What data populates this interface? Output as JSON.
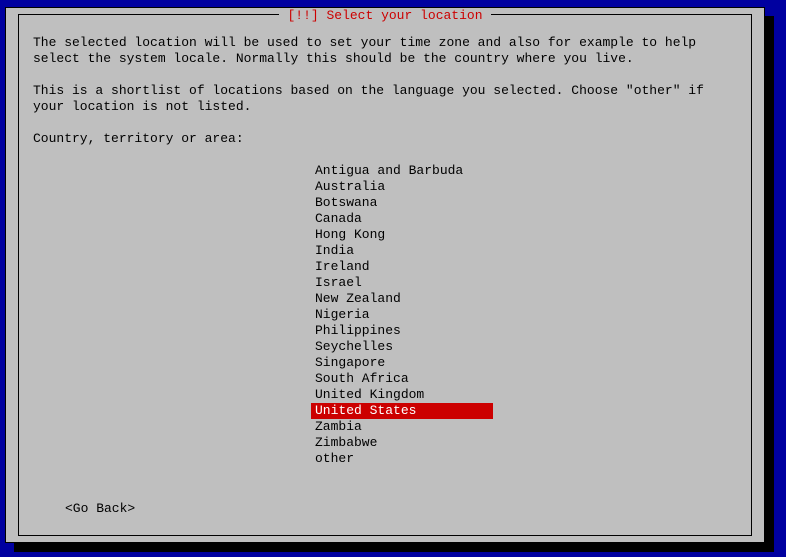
{
  "dialog": {
    "title": "[!!] Select your location",
    "paragraph1": "The selected location will be used to set your time zone and also for example to help select the system locale. Normally this should be the country where you live.",
    "paragraph2": "This is a shortlist of locations based on the language you selected. Choose \"other\" if your location is not listed.",
    "prompt": "Country, territory or area:",
    "items": [
      {
        "label": "Antigua and Barbuda",
        "selected": false
      },
      {
        "label": "Australia",
        "selected": false
      },
      {
        "label": "Botswana",
        "selected": false
      },
      {
        "label": "Canada",
        "selected": false
      },
      {
        "label": "Hong Kong",
        "selected": false
      },
      {
        "label": "India",
        "selected": false
      },
      {
        "label": "Ireland",
        "selected": false
      },
      {
        "label": "Israel",
        "selected": false
      },
      {
        "label": "New Zealand",
        "selected": false
      },
      {
        "label": "Nigeria",
        "selected": false
      },
      {
        "label": "Philippines",
        "selected": false
      },
      {
        "label": "Seychelles",
        "selected": false
      },
      {
        "label": "Singapore",
        "selected": false
      },
      {
        "label": "South Africa",
        "selected": false
      },
      {
        "label": "United Kingdom",
        "selected": false
      },
      {
        "label": "United States",
        "selected": true
      },
      {
        "label": "Zambia",
        "selected": false
      },
      {
        "label": "Zimbabwe",
        "selected": false
      },
      {
        "label": "other",
        "selected": false
      }
    ],
    "go_back": "<Go Back>"
  }
}
